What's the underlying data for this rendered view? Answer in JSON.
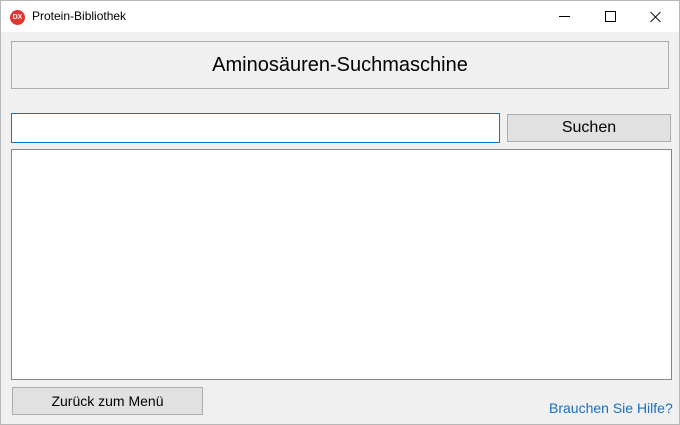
{
  "window": {
    "title": "Protein-Bibliothek",
    "app_icon_text": "DX",
    "app_icon_color": "#e3342f",
    "controls": [
      "minimize",
      "maximize",
      "close"
    ]
  },
  "header": {
    "title": "Aminosäuren-Suchmaschine"
  },
  "search": {
    "value": "",
    "placeholder": "",
    "button_label": "Suchen"
  },
  "results": {
    "items": []
  },
  "footer": {
    "back_label": "Zurück zum Menü",
    "help_label": "Brauchen Sie Hilfe?",
    "link_color": "#1a6fc0"
  }
}
